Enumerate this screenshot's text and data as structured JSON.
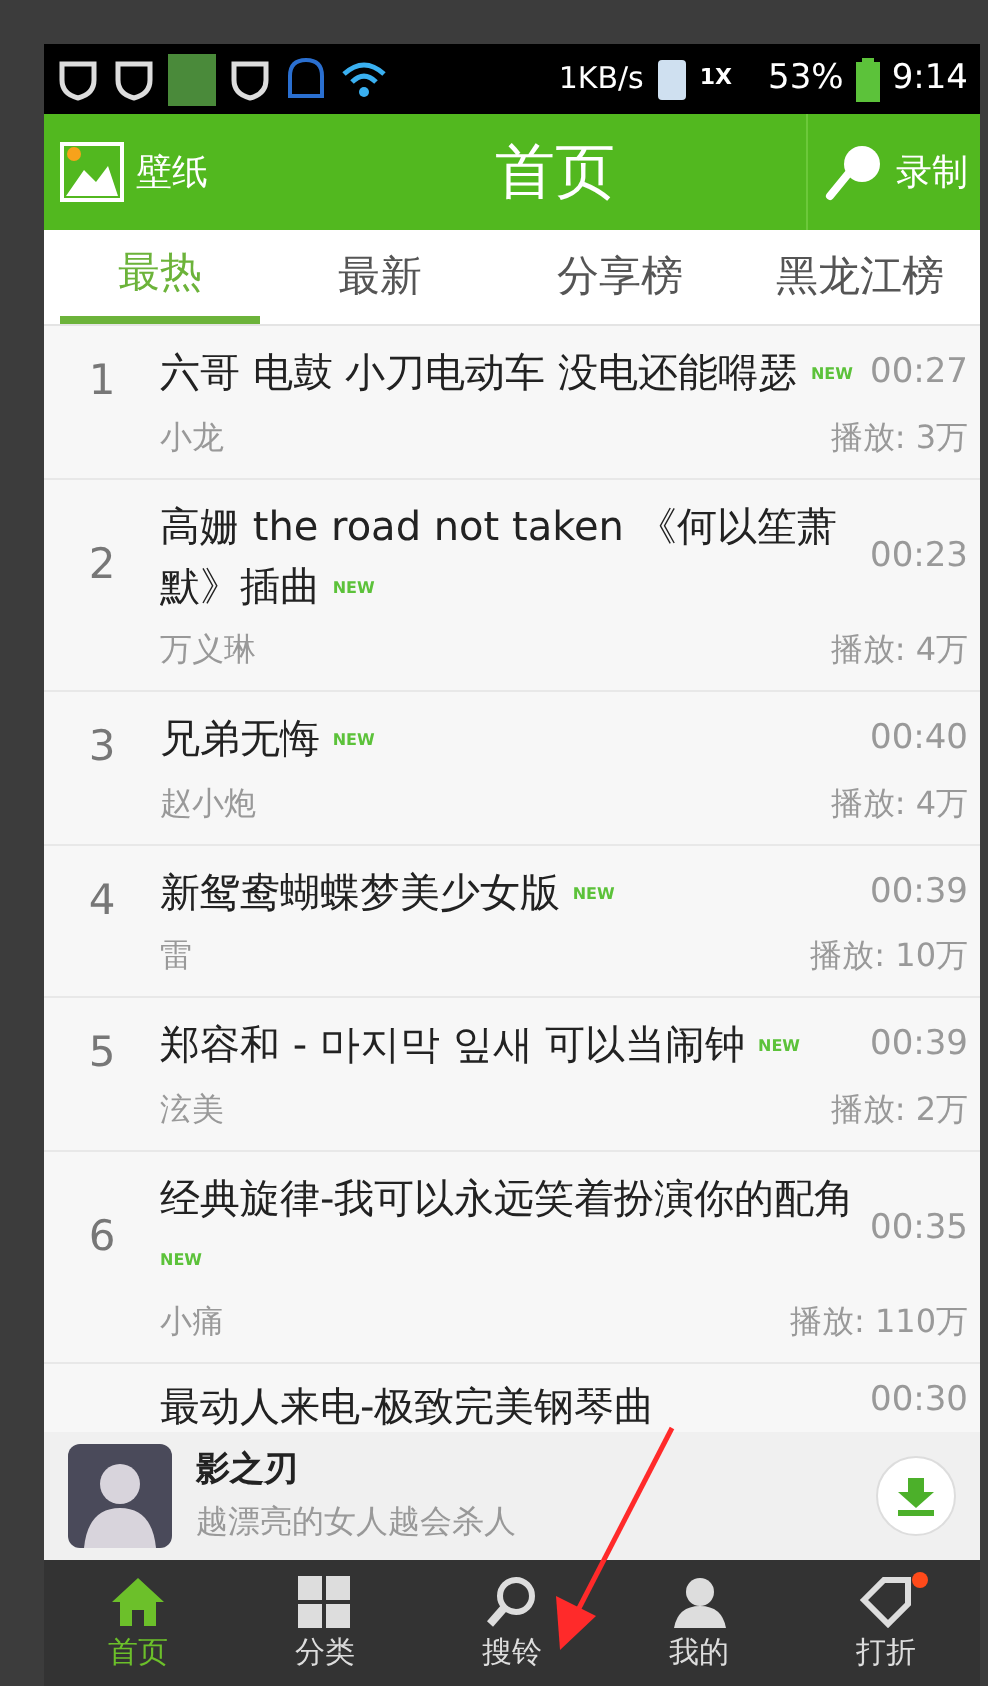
{
  "status_bar": {
    "network_speed": "1KB/s",
    "signal": "1X",
    "battery": "53%",
    "time": "9:14"
  },
  "header": {
    "left": "壁纸",
    "title": "首页",
    "right": "录制"
  },
  "tabs": [
    {
      "label": "最热",
      "selected": true
    },
    {
      "label": "最新",
      "selected": false
    },
    {
      "label": "分享榜",
      "selected": false
    },
    {
      "label": "黑龙江榜",
      "selected": false
    }
  ],
  "songs": [
    {
      "rank": "1",
      "title": "六哥 电鼓 小刀电动车 没电还能嘚瑟",
      "badge": "NEW",
      "duration": "00:27",
      "artist": "小龙",
      "plays": "播放: 3万"
    },
    {
      "rank": "2",
      "title": "高姗 the road not taken 《何以笙萧默》插曲",
      "badge": "NEW",
      "duration": "00:23",
      "artist": "万义琳",
      "plays": "播放: 4万"
    },
    {
      "rank": "3",
      "title": "兄弟无悔",
      "badge": "NEW",
      "duration": "00:40",
      "artist": "赵小炮",
      "plays": "播放: 4万"
    },
    {
      "rank": "4",
      "title": "新鸳鸯蝴蝶梦美少女版",
      "badge": "NEW",
      "duration": "00:39",
      "artist": "雷",
      "plays": "播放: 10万"
    },
    {
      "rank": "5",
      "title": "郑容和 - 마지막 잎새 可以当闹钟",
      "badge": "NEW",
      "duration": "00:39",
      "artist": "泫美",
      "plays": "播放: 2万"
    },
    {
      "rank": "6",
      "title": "经典旋律-我可以永远笑着扮演你的配角",
      "badge": "NEW",
      "duration": "00:35",
      "artist": "小痛",
      "plays": "播放: 110万"
    }
  ],
  "partial_song": {
    "title": "最动人来电-极致完美钢琴曲",
    "duration": "00:30"
  },
  "ad": {
    "title": "影之刃",
    "subtitle": "越漂亮的女人越会杀人"
  },
  "bottom_nav": [
    {
      "label": "首页",
      "selected": true,
      "kind": "home"
    },
    {
      "label": "分类",
      "selected": false,
      "kind": "grid"
    },
    {
      "label": "搜铃",
      "selected": false,
      "kind": "search"
    },
    {
      "label": "我的",
      "selected": false,
      "kind": "person"
    },
    {
      "label": "打折",
      "selected": false,
      "kind": "discount"
    }
  ]
}
